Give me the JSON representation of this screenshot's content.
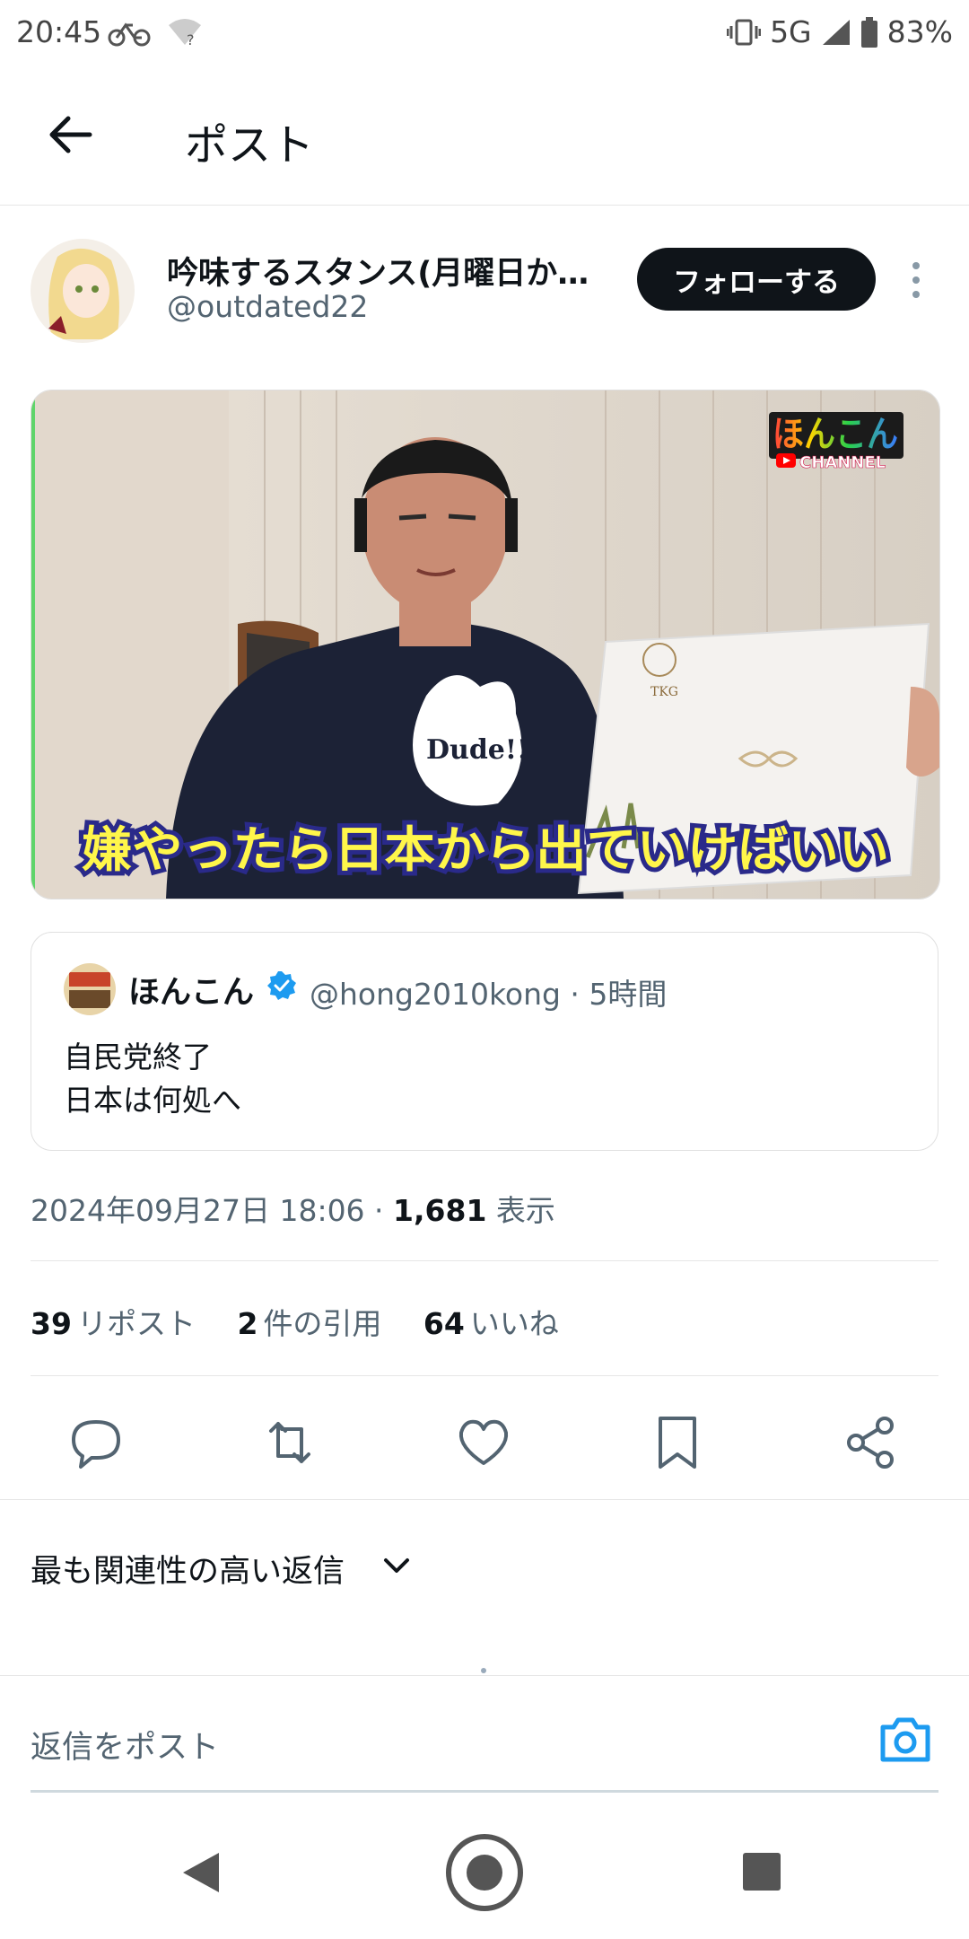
{
  "status": {
    "time": "20:45",
    "network": "5G",
    "battery": "83%"
  },
  "header": {
    "title": "ポスト"
  },
  "author": {
    "name": "吟味するスタンス(月曜日か…",
    "handle": "@outdated22",
    "follow_label": "フォローする"
  },
  "media": {
    "caption": "嫌やったら日本から出ていけばいい",
    "logo_text": "ほんこん",
    "logo_channel": "CHANNEL",
    "shirt_text": "Dude!!",
    "laptop_text": "TKG"
  },
  "quote": {
    "name": "ほんこん",
    "handle": "@hong2010kong · 5時間",
    "text_line1": "自民党終了",
    "text_line2": "日本は何処へ"
  },
  "meta": {
    "datetime": "2024年09月27日 18:06 · ",
    "views": "1,681",
    "views_label": " 表示"
  },
  "stats": {
    "reposts": "39",
    "reposts_label": "リポスト",
    "quotes": "2",
    "quotes_label": "件の引用",
    "likes": "64",
    "likes_label": "いいね"
  },
  "replies": {
    "sort_label": "最も関連性の高い返信",
    "input_placeholder": "返信をポスト"
  },
  "icons": [
    "back-arrow-icon",
    "more-vertical-icon",
    "verified-icon",
    "reply-icon",
    "repost-icon",
    "like-icon",
    "bookmark-icon",
    "share-icon",
    "chevron-down-icon",
    "camera-icon",
    "nav-back-icon",
    "nav-home-icon",
    "nav-recents-icon"
  ],
  "colors": {
    "accent": "#1d9bf0",
    "text": "#0f1419",
    "secondary": "#536471",
    "follow_bg": "#0f1419"
  }
}
